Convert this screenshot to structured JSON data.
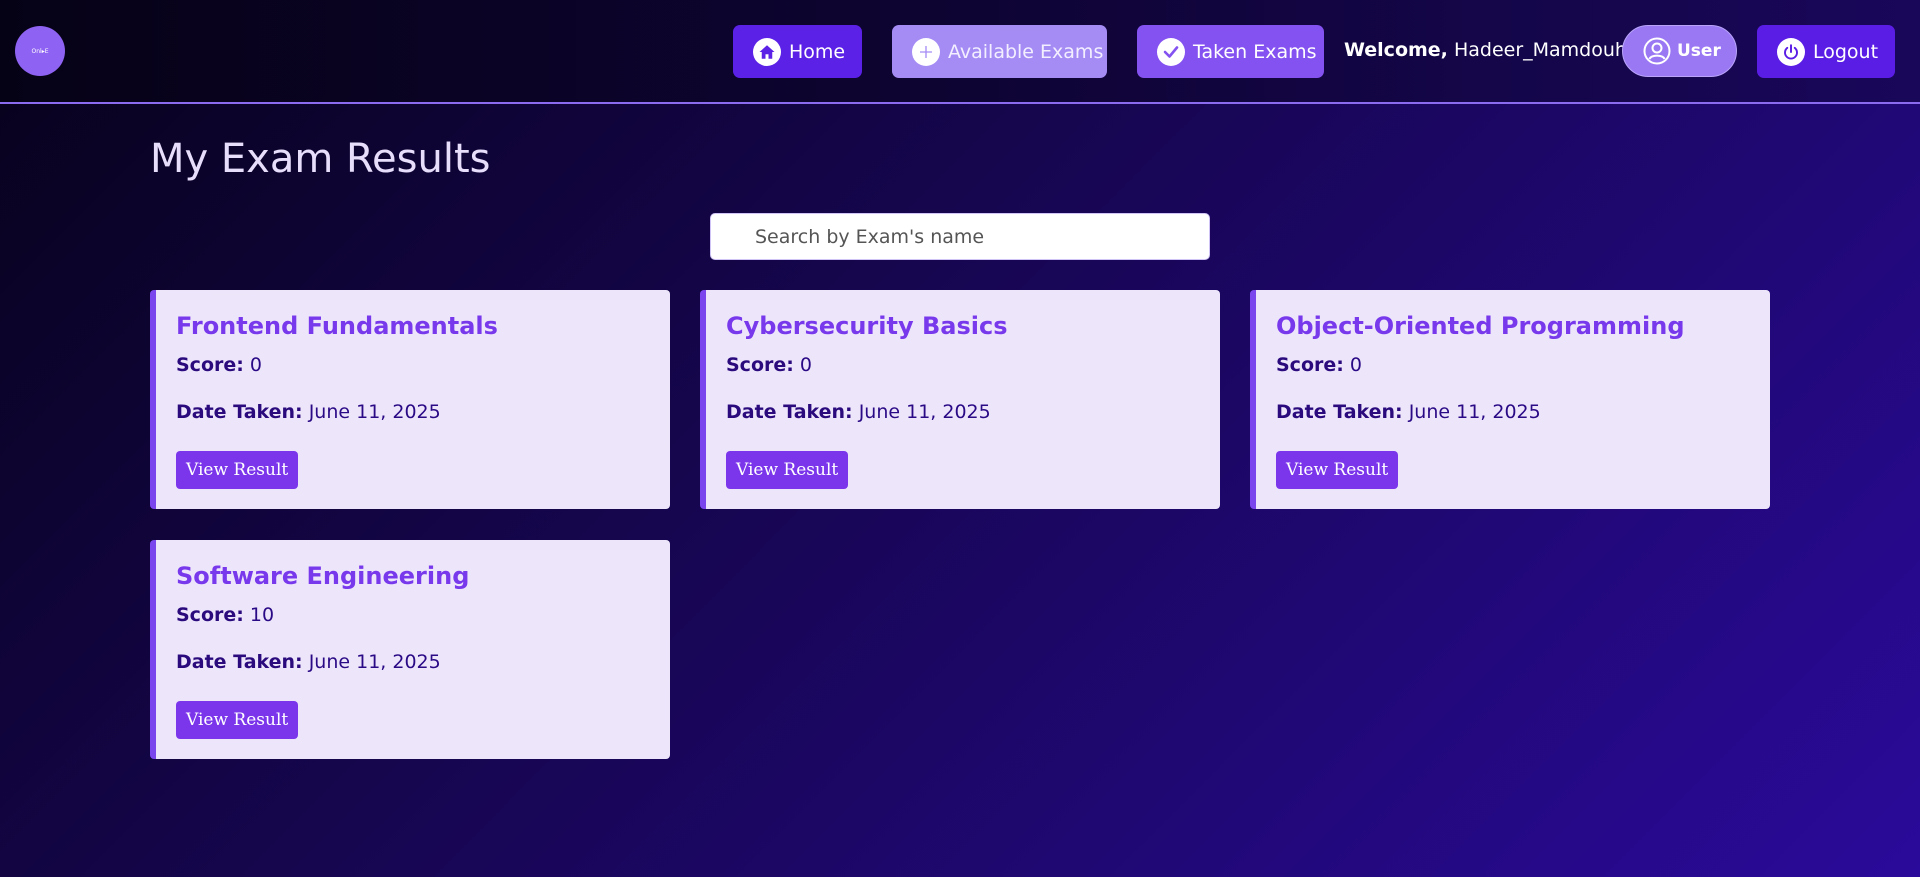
{
  "navbar": {
    "logo_text": "Onl▸E",
    "home_label": "Home",
    "available_label": "Available Exams",
    "taken_label": "Taken Exams",
    "welcome_prefix": "Welcome,",
    "username": "Hadeer_Mamdouh",
    "user_label": "User",
    "logout_label": "Logout",
    "icons": [
      "home-icon",
      "plus-icon",
      "check-icon",
      "user-icon",
      "power-icon"
    ]
  },
  "main": {
    "title": "My Exam Results",
    "search": {
      "placeholder": "Search by Exam's name",
      "value": ""
    },
    "score_label": "Score:",
    "date_label": "Date Taken:",
    "view_label": "View Result",
    "results": [
      {
        "name": "Frontend Fundamentals",
        "score": "0",
        "date": "June 11, 2025"
      },
      {
        "name": "Cybersecurity Basics",
        "score": "0",
        "date": "June 11, 2025"
      },
      {
        "name": "Object-Oriented Programming",
        "score": "0",
        "date": "June 11, 2025"
      },
      {
        "name": "Software Engineering",
        "score": "10",
        "date": "June 11, 2025"
      }
    ]
  },
  "colors": {
    "accent": "#7b36ec",
    "card_bg": "#ede6fb",
    "title_text": "#7838eb",
    "nav_primary": "#5b21e6"
  }
}
